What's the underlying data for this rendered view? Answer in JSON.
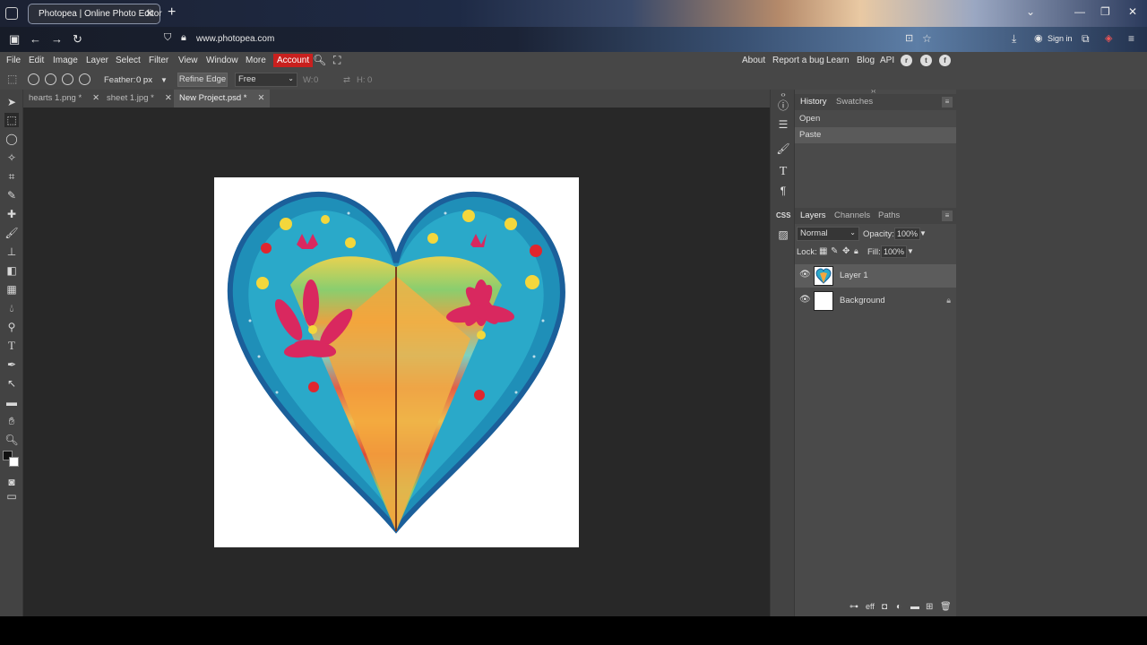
{
  "browser": {
    "tab_title": "Photopea | Online Photo Editor",
    "url": "www.photopea.com",
    "sign_in": "Sign in"
  },
  "menu": {
    "items": [
      "File",
      "Edit",
      "Image",
      "Layer",
      "Select",
      "Filter",
      "View",
      "Window",
      "More"
    ],
    "account": "Account",
    "right": [
      "About",
      "Report a bug",
      "Learn",
      "Blog",
      "API"
    ]
  },
  "options": {
    "feather_label": "Feather:",
    "feather_value": "0 px",
    "refine_edge": "Refine Edge",
    "style_value": "Free",
    "w_label": "W:",
    "w_value": "0",
    "h_label": "H:",
    "h_value": "0"
  },
  "doc_tabs": [
    {
      "label": "hearts 1.png *"
    },
    {
      "label": "sheet 1.jpg *"
    },
    {
      "label": "New Project.psd *"
    }
  ],
  "history": {
    "tabs": [
      "History",
      "Swatches"
    ],
    "items": [
      "Open",
      "Paste"
    ]
  },
  "layers_panel": {
    "tabs": [
      "Layers",
      "Channels",
      "Paths"
    ],
    "blend_mode": "Normal",
    "opacity_label": "Opacity:",
    "opacity_value": "100%",
    "lock_label": "Lock:",
    "fill_label": "Fill:",
    "fill_value": "100%",
    "layers": [
      {
        "name": "Layer 1"
      },
      {
        "name": "Background"
      }
    ]
  },
  "colors": {
    "accent_red": "#c8201e",
    "workspace": "#282828",
    "panel": "#4a4a4a"
  }
}
